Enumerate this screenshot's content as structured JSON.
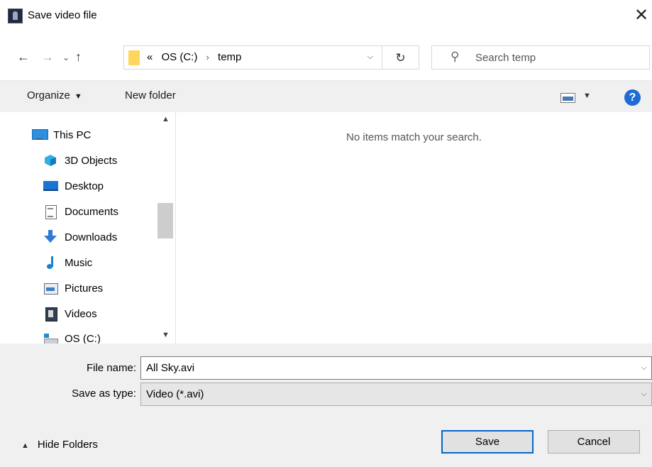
{
  "window": {
    "title": "Save video file",
    "close_glyph": "✕"
  },
  "nav": {
    "back_glyph": "←",
    "forward_glyph": "→",
    "recent_glyph": "⌄",
    "up_glyph": "↑",
    "address": {
      "overflow": "«",
      "segments": [
        "OS (C:)",
        "temp"
      ],
      "separator": "›"
    },
    "refresh_glyph": "↻",
    "search_placeholder": "Search temp",
    "search_glyph": "⚲"
  },
  "toolbar": {
    "organize_label": "Organize",
    "new_folder_label": "New folder",
    "help_glyph": "?"
  },
  "sidebar": {
    "items": [
      {
        "label": "This PC",
        "icon": "computer-icon"
      },
      {
        "label": "3D Objects",
        "icon": "cube-icon"
      },
      {
        "label": "Desktop",
        "icon": "desktop-icon"
      },
      {
        "label": "Documents",
        "icon": "document-icon"
      },
      {
        "label": "Downloads",
        "icon": "download-arrow-icon"
      },
      {
        "label": "Music",
        "icon": "music-note-icon"
      },
      {
        "label": "Pictures",
        "icon": "picture-icon"
      },
      {
        "label": "Videos",
        "icon": "film-icon"
      },
      {
        "label": "OS (C:)",
        "icon": "drive-icon"
      }
    ]
  },
  "content": {
    "empty_message": "No items match your search."
  },
  "form": {
    "file_name_label": "File name:",
    "file_name_value": "All Sky.avi",
    "save_type_label": "Save as type:",
    "save_type_value": "Video (*.avi)"
  },
  "footer": {
    "hide_folders_label": "Hide Folders",
    "save_label": "Save",
    "cancel_label": "Cancel"
  }
}
